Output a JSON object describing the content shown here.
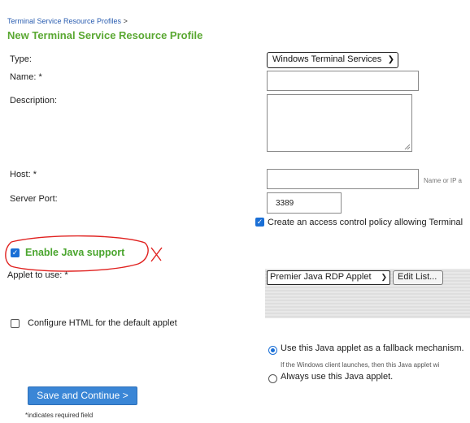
{
  "breadcrumb": {
    "link": "Terminal Service Resource Profiles",
    "separator": ">"
  },
  "page_title": "New Terminal Service Resource Profile",
  "form": {
    "type_label": "Type:",
    "type_value": "Windows Terminal Services",
    "name_label": "Name: *",
    "name_value": "",
    "description_label": "Description:",
    "description_value": "",
    "host_label": "Host: *",
    "host_value": "",
    "host_hint": "Name or IP a",
    "port_label": "Server Port:",
    "port_value": "3389",
    "acl_checkbox_label": "Create an access control policy allowing Terminal",
    "java_support_label": "Enable Java support",
    "applet_label": "Applet to use: *",
    "applet_value": "Premier Java RDP Applet",
    "edit_list_label": "Edit List...",
    "configure_html_label": "Configure HTML for the default applet",
    "fallback_radio_label": "Use this Java applet as a fallback mechanism.",
    "fallback_note": "If the Windows client launches, then this Java applet wi",
    "always_radio_label": "Always use this Java applet."
  },
  "annotation": {
    "mark": "X",
    "color": "#e0201e"
  },
  "actions": {
    "save_label": "Save and Continue >"
  },
  "footer": {
    "required_note": "*indicates required field"
  },
  "colors": {
    "accent_green": "#5aa832",
    "button_blue": "#3a86d6",
    "link_blue": "#2a5db0"
  },
  "state": {
    "acl_checked": true,
    "java_support_checked": true,
    "configure_html_checked": false,
    "fallback_selected": true
  }
}
